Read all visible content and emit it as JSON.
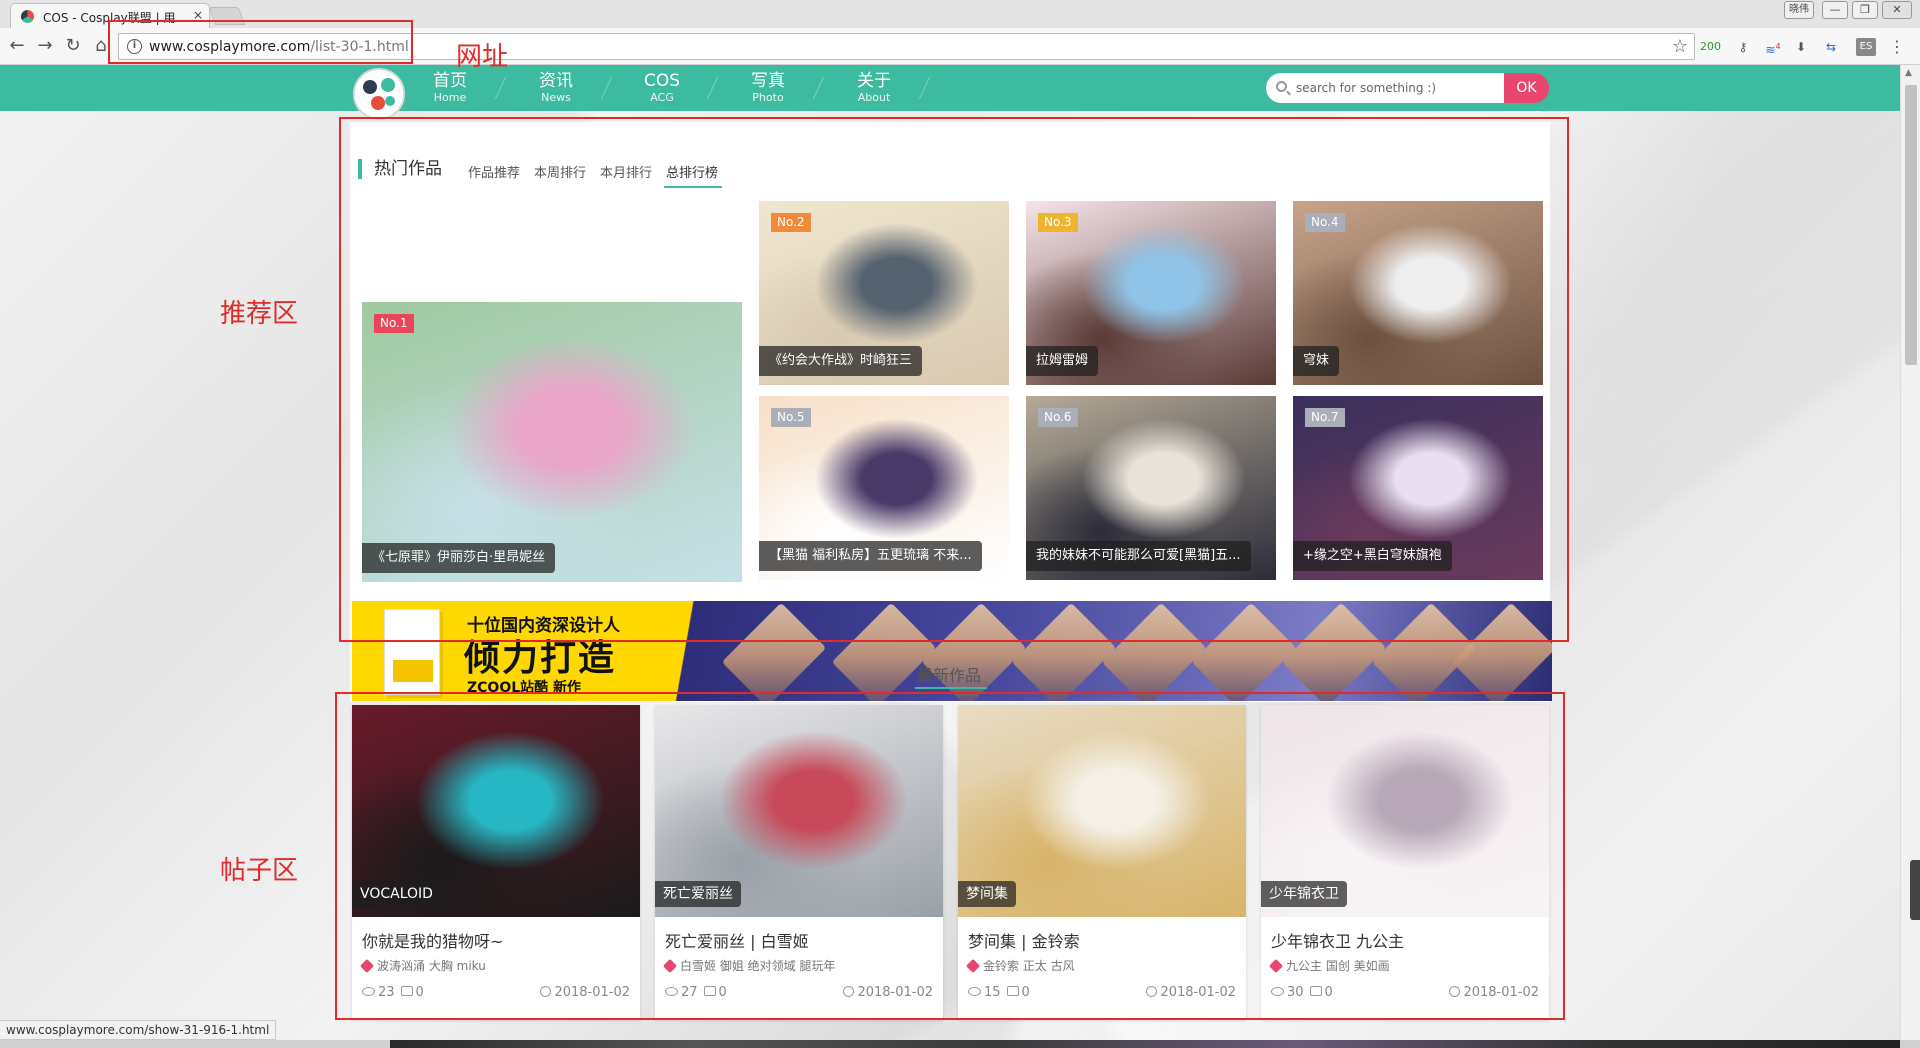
{
  "browser": {
    "tab_title": "COS - Cosplay联盟 | 用",
    "tab_close": "×",
    "window_controls": [
      "晓伟",
      "—",
      "❐",
      "✕"
    ],
    "url_host": "www.cosplaymore.com",
    "url_path": "/list-30-1.html",
    "ext_count": "200",
    "ext_badge": "4",
    "ext_es": "ES",
    "status_url": "www.cosplaymore.com/show-31-916-1.html"
  },
  "annotations": {
    "url_label": "网址",
    "recommend_label": "推荐区",
    "posts_label": "帖子区"
  },
  "site": {
    "nav": [
      {
        "cn": "首页",
        "en": "Home"
      },
      {
        "cn": "资讯",
        "en": "News"
      },
      {
        "cn": "COS",
        "en": "ACG"
      },
      {
        "cn": "写真",
        "en": "Photo"
      },
      {
        "cn": "关于",
        "en": "About"
      }
    ],
    "search_placeholder": "search for something :)",
    "search_button": "OK"
  },
  "hot": {
    "title": "热门作品",
    "tabs": [
      "作品推荐",
      "本周排行",
      "本月排行",
      "总排行榜"
    ],
    "items": [
      {
        "rank": "No.1",
        "caption": "《七原罪》伊丽莎白·里昂妮丝",
        "palette": [
          "#9fc9a0",
          "#e9a6c8",
          "#c7e0e8"
        ]
      },
      {
        "rank": "No.2",
        "caption": "《约会大作战》时崎狂三",
        "palette": [
          "#f0e6cf",
          "#55626f",
          "#d8c9b0"
        ]
      },
      {
        "rank": "No.3",
        "caption": "拉姆雷姆",
        "palette": [
          "#f6e4e8",
          "#8fc4e8",
          "#5a3a36"
        ]
      },
      {
        "rank": "No.4",
        "caption": "穹妹",
        "palette": [
          "#c7a48a",
          "#eeeeee",
          "#6d5140"
        ]
      },
      {
        "rank": "No.5",
        "caption": "【黑猫 福利私房】五更琉璃 不来...",
        "palette": [
          "#f7e0c8",
          "#4a3a6a",
          "#ffffff"
        ]
      },
      {
        "rank": "No.6",
        "caption": "我的妹妹不可能那么可爱[黑猫]五...",
        "palette": [
          "#b5aa96",
          "#e8e2d8",
          "#2c2c3a"
        ]
      },
      {
        "rank": "No.7",
        "caption": "+缘之空+黑白穹妹旗袍",
        "palette": [
          "#3a2f5c",
          "#e8e0f0",
          "#6a3a5c"
        ]
      }
    ]
  },
  "banner": {
    "small": "十位国内资深设计人",
    "big": "倾力打造",
    "brand": "ZCOOL站酷 新作"
  },
  "latest": {
    "title": "最新作品",
    "posts": [
      {
        "tag": "VOCALOID",
        "title": "你就是我的猎物呀~",
        "tags": "波涛汹涌 大胸 miku",
        "views": "23",
        "comments": "0",
        "date": "2018-01-02",
        "palette": [
          "#6a1a2a",
          "#27b7c4",
          "#1a1a1a"
        ]
      },
      {
        "tag": "死亡爱丽丝",
        "title": "死亡爱丽丝 | 白雪姬",
        "tags": "白雪姬 御姐 绝对领域 腿玩年",
        "views": "27",
        "comments": "0",
        "date": "2018-01-02",
        "palette": [
          "#e8e8ea",
          "#c84a5a",
          "#9aa0a8"
        ]
      },
      {
        "tag": "梦间集",
        "title": "梦间集 | 金铃索",
        "tags": "金铃索 正太 古风",
        "views": "15",
        "comments": "0",
        "date": "2018-01-02",
        "palette": [
          "#e8dcc4",
          "#f4f0e6",
          "#d8b46a"
        ]
      },
      {
        "tag": "少年锦衣卫",
        "title": "少年锦衣卫 九公主",
        "tags": "九公主 国创 美如画",
        "views": "30",
        "comments": "0",
        "date": "2018-01-02",
        "palette": [
          "#efe4e8",
          "#b8a8b8",
          "#f8f4f6"
        ]
      }
    ]
  },
  "colors": {
    "accent": "#3dbba0",
    "search_button": "#e8466f",
    "annotation": "#e02b2b"
  }
}
